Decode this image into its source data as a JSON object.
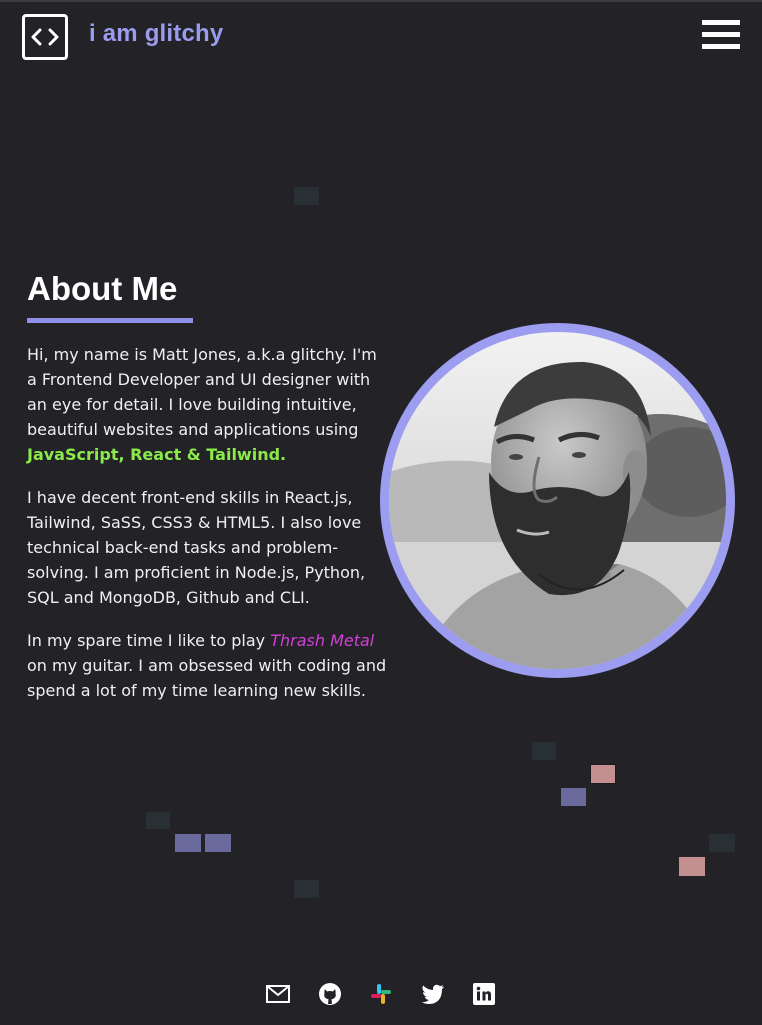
{
  "header": {
    "brand": "i am glitchy",
    "logo_icon": "code-brackets-icon",
    "menu_icon": "hamburger-menu-icon"
  },
  "about": {
    "title": "About Me",
    "p1_text": "Hi, my name is Matt Jones, a.k.a glitchy. I'm a Frontend Developer and UI designer with an eye for detail. I love building intuitive, beautiful websites and applications using ",
    "p1_highlight": "JavaScript, React & Tailwind.",
    "p2": "I have decent front-end skills in React.js, Tailwind, SaSS, CSS3 & HTML5. I also love technical back-end tasks and problem-solving. I am proficient in Node.js, Python, SQL and MongoDB, Github and CLI.",
    "p3_before": "In my spare time I like to play ",
    "p3_highlight": "Thrash Metal",
    "p3_after": " on my guitar. I am obsessed with coding and spend a lot of my time learning new skills."
  },
  "footer": {
    "social_icons": [
      "mail-icon",
      "github-icon",
      "slack-icon",
      "twitter-icon",
      "linkedin-icon"
    ]
  },
  "colors": {
    "background": "#232327",
    "accent": "#9b9cee",
    "green": "#8bea4a",
    "pink": "#d23fd8",
    "glitch_blue": "#6a6b9c",
    "glitch_red": "#c48f8f"
  }
}
